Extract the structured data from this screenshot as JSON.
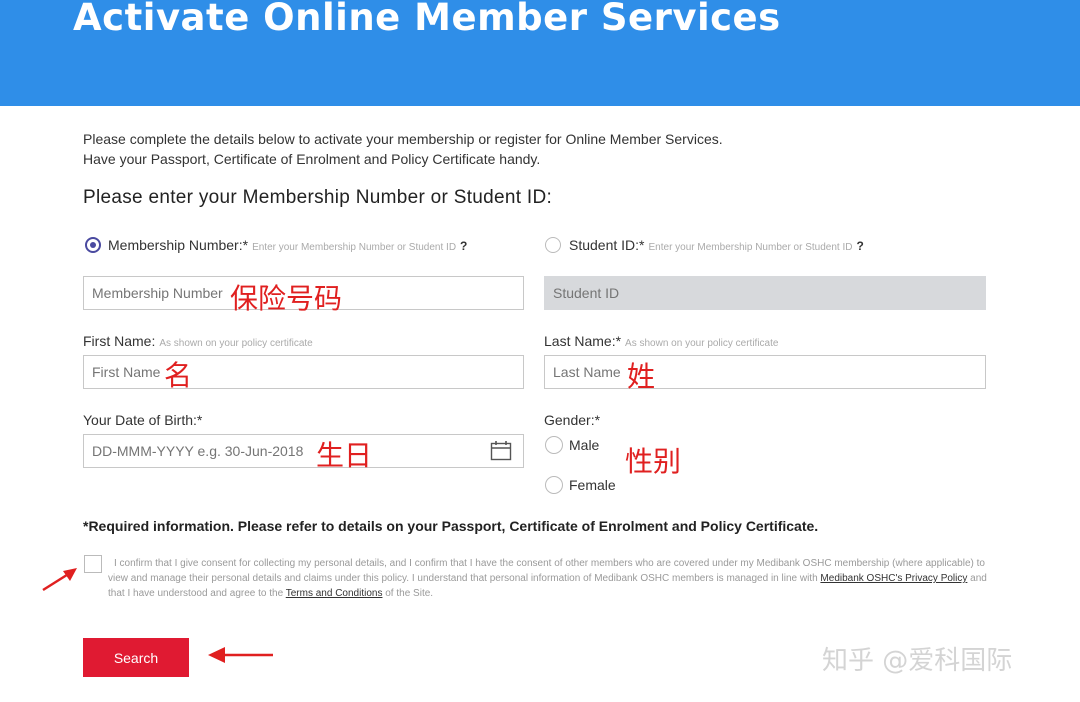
{
  "header": {
    "title": "Activate Online Member Services"
  },
  "intro": {
    "line1": "Please complete the details below to activate your membership or register for Online Member Services.",
    "line2": "Have your Passport, Certificate of Enrolment and Policy Certificate handy."
  },
  "section_title": "Please enter your Membership Number or Student ID:",
  "membership": {
    "label": "Membership Number:*",
    "hint": "Enter your Membership Number or Student ID",
    "help": "?",
    "placeholder": "Membership Number",
    "selected": true,
    "annotation": "保险号码"
  },
  "student": {
    "label": "Student ID:*",
    "hint": "Enter your Membership Number or Student ID",
    "help": "?",
    "placeholder": "Student ID"
  },
  "first_name": {
    "label": "First Name:",
    "hint": "As shown on your policy certificate",
    "placeholder": "First Name",
    "annotation": "名"
  },
  "last_name": {
    "label": "Last Name:*",
    "hint": "As shown on your policy certificate",
    "placeholder": "Last Name",
    "annotation": "姓"
  },
  "dob": {
    "label": "Your Date of Birth:*",
    "placeholder": "DD-MMM-YYYY e.g. 30-Jun-2018",
    "icon": "calendar-icon",
    "annotation": "生日"
  },
  "gender": {
    "label": "Gender:*",
    "options": [
      "Male",
      "Female"
    ],
    "annotation": "性别"
  },
  "required_note": "*Required information. Please refer to details on your Passport, Certificate of Enrolment and Policy Certificate.",
  "consent": {
    "text_a": "I confirm that I give consent for collecting my personal details, and I confirm that I have the consent of other members who are covered under my Medibank OSHC membership (where applicable) to view and manage their personal details and claims under this policy. I understand that personal information of Medibank OSHC members is managed in line with",
    "privacy_link": "Medibank OSHC's Privacy Policy",
    "text_b": "and that I have understood and agree to the",
    "terms_link": "Terms and Conditions",
    "text_c": "of the Site."
  },
  "search_button": "Search",
  "watermark": "知乎 @爱科国际",
  "colors": {
    "header": "#2f8ee8",
    "button": "#e01a32",
    "annotation": "#e02020",
    "radio": "#4a4aa0"
  }
}
